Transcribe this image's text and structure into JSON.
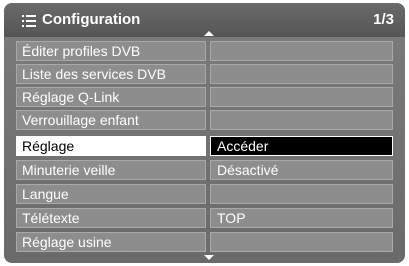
{
  "header": {
    "icon": "menu-list-icon",
    "title": "Configuration",
    "page": "1/3"
  },
  "scroll": {
    "up_icon": "scroll-up-arrow-icon",
    "down_icon": "scroll-down-arrow-icon"
  },
  "rows": [
    {
      "label": "Éditer profiles DVB",
      "value": "",
      "selected": false
    },
    {
      "label": "Liste des services DVB",
      "value": "",
      "selected": false
    },
    {
      "label": "Réglage Q-Link",
      "value": "",
      "selected": false
    },
    {
      "label": "Verrouillage enfant",
      "value": "",
      "selected": false
    },
    {
      "label": "Réglage",
      "value": "Accéder",
      "selected": true
    },
    {
      "label": "Minuterie veille",
      "value": "Désactivé",
      "selected": false
    },
    {
      "label": "Langue",
      "value": "",
      "selected": false
    },
    {
      "label": "Télétexte",
      "value": "TOP",
      "selected": false
    },
    {
      "label": "Réglage usine",
      "value": "",
      "selected": false
    }
  ],
  "colors": {
    "panel": "#777777",
    "row": "#8d8d8d",
    "selected_label_bg": "#ffffff",
    "selected_value_bg": "#000000",
    "text": "#ffffff"
  }
}
